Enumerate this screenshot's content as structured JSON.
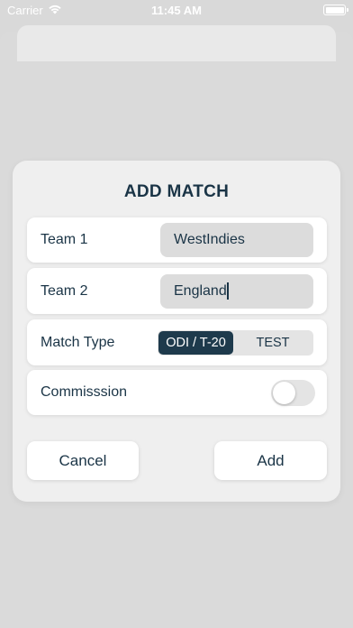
{
  "status_bar": {
    "carrier": "Carrier",
    "time": "11:45 AM",
    "wifi_icon": "wifi-icon",
    "battery_icon": "battery-icon",
    "battery_level": 1.0
  },
  "dialog": {
    "title": "ADD MATCH",
    "team1": {
      "label": "Team 1",
      "value": "WestIndies"
    },
    "team2": {
      "label": "Team 2",
      "value": "England"
    },
    "match_type": {
      "label": "Match Type",
      "options": [
        "ODI / T-20",
        "TEST"
      ],
      "selected": "ODI / T-20"
    },
    "commission": {
      "label": "Commisssion",
      "enabled": false
    },
    "cancel_label": "Cancel",
    "add_label": "Add"
  },
  "colors": {
    "accent": "#1e3a4c",
    "text": "#1a3446",
    "background": "#d9d9d9",
    "card": "#efefef"
  }
}
